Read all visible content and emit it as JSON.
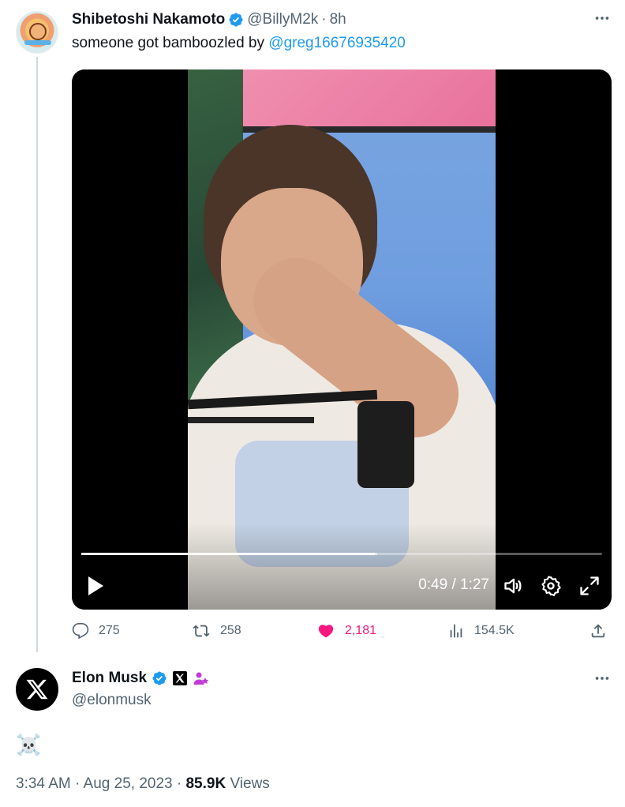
{
  "parent_tweet": {
    "author_name": "Shibetoshi Nakamoto",
    "handle": "@BillyM2k",
    "separator": "·",
    "time_ago": "8h",
    "text_prefix": "someone got bamboozled by ",
    "mention": "@greg16676935420",
    "video": {
      "current_time": "0:49",
      "duration": "1:27",
      "time_display": "0:49 / 1:27",
      "progress_fraction": 0.563,
      "buffered_fraction": 0.568
    },
    "actions": {
      "replies": "275",
      "retweets": "258",
      "likes": "2,181",
      "views": "154.5K"
    }
  },
  "reply_tweet": {
    "author_name": "Elon Musk",
    "handle": "@elonmusk",
    "text": "☠️",
    "timestamp": "3:34 AM · Aug 25, 2023 · ",
    "views_count": "85.9K",
    "views_label": " Views"
  },
  "icons": {
    "more": "more-icon",
    "verified": "verified-badge-icon",
    "reply": "reply-icon",
    "retweet": "retweet-icon",
    "like": "heart-icon",
    "views": "views-bar-icon",
    "share": "share-icon"
  },
  "colors": {
    "accent": "#1d9bf0",
    "like": "#f91880",
    "secondary_text": "#536471"
  }
}
